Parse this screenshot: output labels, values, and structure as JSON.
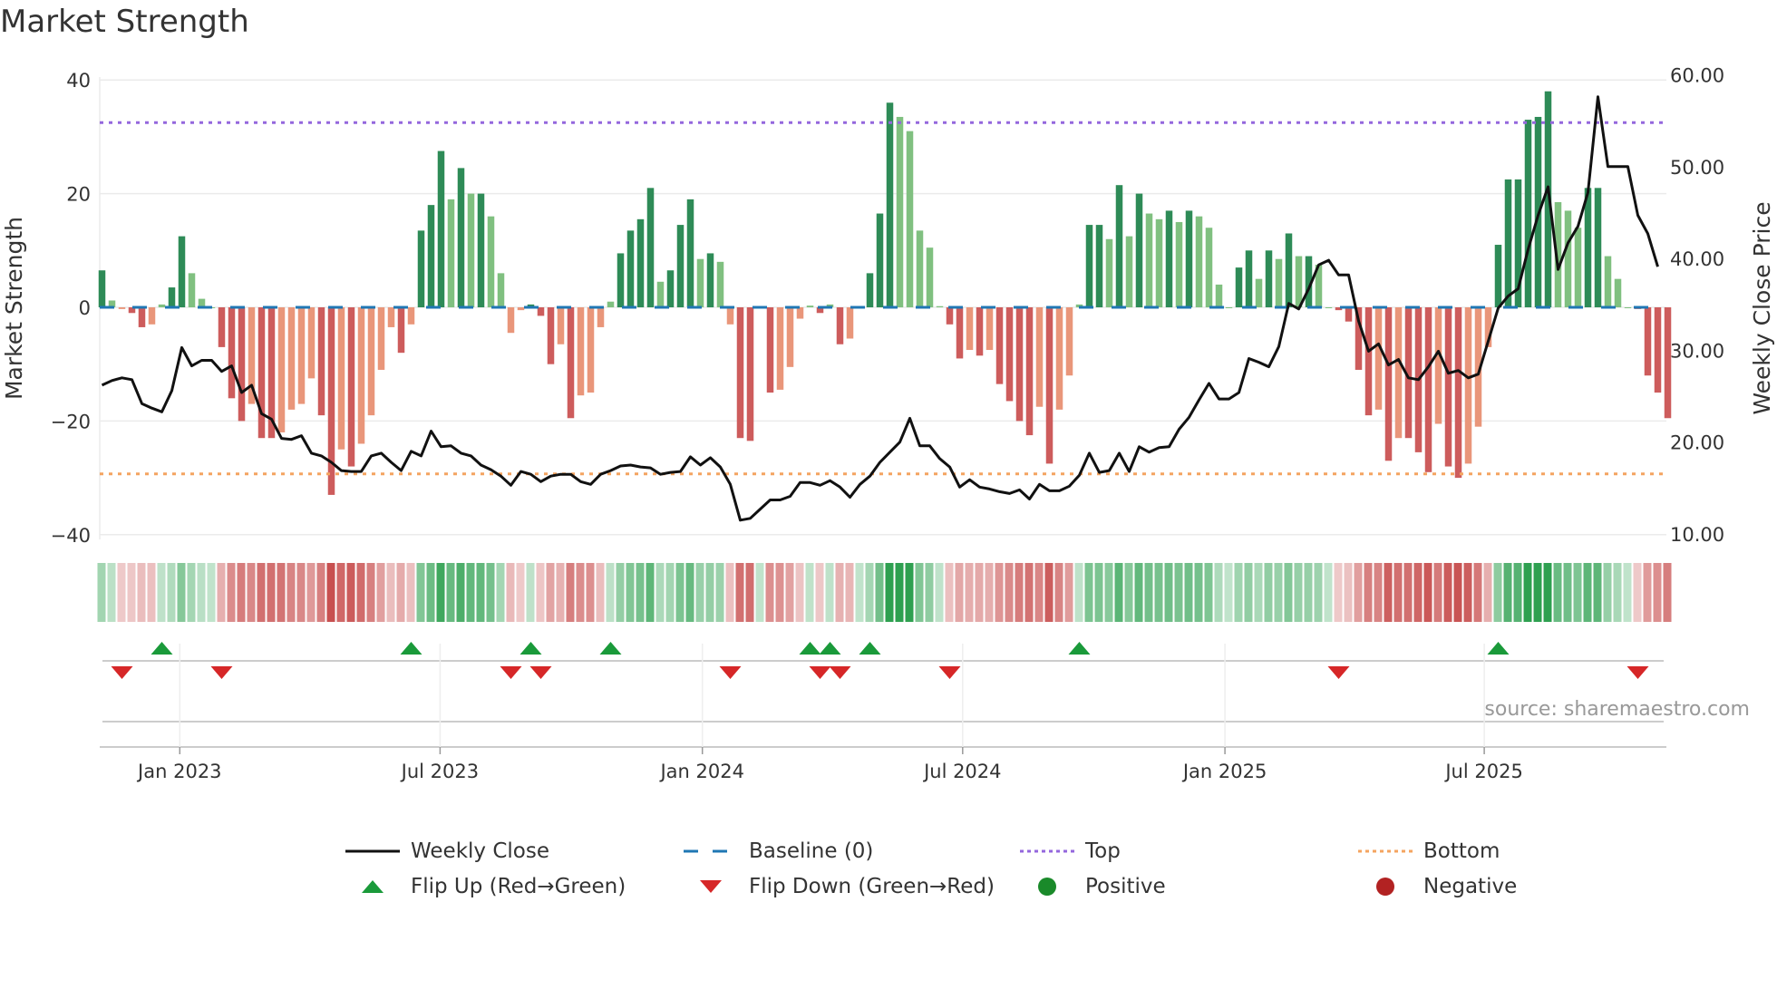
{
  "chart_data": {
    "type": "bar",
    "title": "Market Strength",
    "ylabel": "Market Strength",
    "y2label": "Weekly Close Price",
    "ylim": [
      -40,
      40
    ],
    "y2lim": [
      10,
      60
    ],
    "yticks": [
      "40",
      "20",
      "0",
      "−20",
      "−40"
    ],
    "ytick_values": [
      40,
      20,
      0,
      -20,
      -40
    ],
    "y2ticks": [
      "60.00",
      "50.00",
      "40.00",
      "30.00",
      "20.00",
      "10.00"
    ],
    "y2tick_values": [
      60,
      50,
      40,
      30,
      20,
      10
    ],
    "xticks": [
      {
        "label": "Jan 2023",
        "week": 7.8
      },
      {
        "label": "Jul 2023",
        "week": 33.9
      },
      {
        "label": "Jan 2024",
        "week": 60.2
      },
      {
        "label": "Jul 2024",
        "week": 86.3
      },
      {
        "label": "Jan 2025",
        "week": 112.6
      },
      {
        "label": "Jul 2025",
        "week": 138.6
      }
    ],
    "top_level": 32.5,
    "bottom_level": -29.3,
    "strength": [
      6.5,
      1.2,
      -0.3,
      -1,
      -3.5,
      -3,
      0.5,
      3.5,
      12.5,
      6,
      1.5,
      0,
      -7,
      -16,
      -20,
      -17,
      -23,
      -23,
      -22,
      -18,
      -17,
      -12.5,
      -19,
      -33,
      -25,
      -28,
      -24,
      -19,
      -11,
      -3.5,
      -8,
      -3,
      13.5,
      18,
      27.5,
      19,
      24.5,
      20,
      20,
      16,
      6,
      -4.5,
      -0.5,
      0.5,
      -1.5,
      -10,
      -6.5,
      -19.5,
      -15.5,
      -15,
      -3.5,
      1,
      9.5,
      13.5,
      15.5,
      21,
      4.5,
      6.5,
      14.5,
      19,
      8.5,
      9.5,
      8,
      -3,
      -23,
      -23.5,
      0,
      -15,
      -14.5,
      -10.5,
      -2,
      0.3,
      -1,
      0.5,
      -6.5,
      -5.5,
      0,
      6,
      16.5,
      36,
      33.5,
      31,
      13.5,
      10.5,
      0.2,
      -3,
      -9,
      -7.5,
      -8.5,
      -7.5,
      -13.5,
      -16.5,
      -20,
      -22.5,
      -17.5,
      -27.5,
      -18,
      -12,
      0.5,
      14.5,
      14.5,
      12,
      21.5,
      12.5,
      20,
      16.5,
      15.5,
      17,
      15,
      17,
      16,
      14,
      4,
      0,
      7,
      10,
      5,
      10,
      8.5,
      13,
      9,
      9,
      7.5,
      0,
      -0.5,
      -2.5,
      -11,
      -19,
      -18,
      -27,
      -23,
      -23,
      -25.5,
      -29,
      -20.5,
      -28,
      -30,
      -27.5,
      -21,
      -7,
      11,
      22.5,
      22.5,
      33,
      33.5,
      38,
      18.5,
      17,
      14,
      21,
      21,
      9,
      5,
      0,
      -0.3,
      -12,
      -15,
      -19.5
    ],
    "weekly_close": [
      26.2,
      26.7,
      27,
      26.8,
      24.2,
      23.7,
      23.3,
      25.6,
      30.3,
      28.3,
      28.9,
      28.9,
      27.7,
      28.3,
      25.4,
      26.2,
      23.1,
      22.5,
      20.4,
      20.3,
      20.7,
      18.8,
      18.5,
      17.8,
      16.9,
      16.8,
      16.8,
      18.5,
      18.8,
      17.8,
      16.9,
      19,
      18.5,
      21.2,
      19.5,
      19.6,
      18.8,
      18.5,
      17.5,
      17,
      16.3,
      15.3,
      16.8,
      16.5,
      15.7,
      16.3,
      16.5,
      16.5,
      15.7,
      15.4,
      16.5,
      16.9,
      17.4,
      17.5,
      17.3,
      17.2,
      16.5,
      16.7,
      16.8,
      18.4,
      17.5,
      18.3,
      17.3,
      15.4,
      11.5,
      11.7,
      12.7,
      13.7,
      13.7,
      14.1,
      15.6,
      15.6,
      15.3,
      15.8,
      15.1,
      14,
      15.4,
      16.3,
      17.8,
      18.9,
      20,
      22.6,
      19.6,
      19.6,
      18.2,
      17.3,
      15.1,
      15.9,
      15.1,
      14.9,
      14.6,
      14.4,
      14.8,
      13.8,
      15.4,
      14.7,
      14.7,
      15.2,
      16.4,
      18.8,
      16.7,
      16.9,
      18.8,
      16.8,
      19.5,
      18.9,
      19.4,
      19.5,
      21.4,
      22.7,
      24.6,
      26.4,
      24.7,
      24.7,
      25.4,
      29.1,
      28.7,
      28.2,
      30.4,
      35.1,
      34.5,
      36.7,
      39.3,
      39.8,
      38.2,
      38.2,
      33.2,
      29.9,
      30.7,
      28.4,
      29,
      27,
      26.8,
      28.2,
      29.9,
      27.5,
      27.8,
      27,
      27.4,
      31,
      34.6,
      35.9,
      36.7,
      41,
      44.7,
      47.8,
      38.8,
      41.7,
      43.5,
      47.2,
      57.6,
      50,
      50,
      50,
      44.7,
      42.7,
      39.1
    ],
    "flip_up_weeks": [
      6,
      31,
      43,
      51,
      71,
      73,
      77,
      98,
      140
    ],
    "flip_down_weeks": [
      2,
      12,
      41,
      44,
      63,
      72,
      74,
      85,
      124,
      154
    ],
    "colors": {
      "positive_rising": "#2e8b57",
      "positive_falling": "#80c080",
      "negative_falling": "#cd5c5c",
      "negative_rising": "#e9967a",
      "baseline": "#1f77b4",
      "top": "#9467dd",
      "bottom": "#f4a460",
      "close": "#111111",
      "flip_up": "#1a9a3a",
      "flip_down": "#d62728",
      "positive_dot": "#1a8a2a",
      "negative_dot": "#b22222"
    },
    "legend": [
      {
        "label": "Weekly Close",
        "kind": "line"
      },
      {
        "label": "Baseline (0)",
        "kind": "dashed"
      },
      {
        "label": "Top",
        "kind": "dotted-top"
      },
      {
        "label": "Bottom",
        "kind": "dotted-bottom"
      },
      {
        "label": "Flip Up (Red→Green)",
        "kind": "tri-up"
      },
      {
        "label": "Flip Down (Green→Red)",
        "kind": "tri-down"
      },
      {
        "label": "Positive",
        "kind": "dot-pos"
      },
      {
        "label": "Negative",
        "kind": "dot-neg"
      }
    ],
    "legend_position": "bottom"
  },
  "source": "source: sharemaestro.com"
}
